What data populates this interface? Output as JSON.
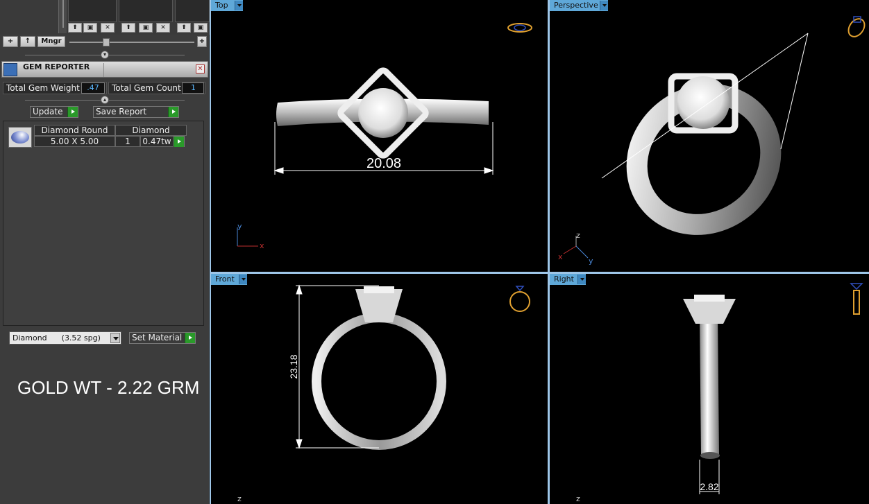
{
  "left_panel": {
    "toolbar": {
      "add_label": "+",
      "up_label": "↑",
      "manager_label": "Mngr",
      "plus_right_label": "+"
    },
    "gem_reporter": {
      "title": "GEM REPORTER",
      "total_gem_weight_label": "Total Gem Weight",
      "total_gem_weight_value": ".47",
      "total_gem_count_label": "Total Gem Count",
      "total_gem_count_value": "1",
      "update_label": "Update",
      "save_report_label": "Save Report",
      "gems": [
        {
          "shape": "Diamond Round",
          "material": "Diamond",
          "size": "5.00 X 5.00",
          "count": "1",
          "weight": "0.47tw"
        }
      ],
      "material_select": "Diamond      (3.52 spg)",
      "set_material_label": "Set Material"
    },
    "gold_weight": "GOLD WT - 2.22 GRM"
  },
  "viewports": {
    "top": {
      "label": "Top",
      "dimension": "20.08",
      "axis_x": "x",
      "axis_y": "y"
    },
    "perspective": {
      "label": "Perspective",
      "axis_x": "x",
      "axis_y": "y",
      "axis_z": "z"
    },
    "front": {
      "label": "Front",
      "dimension": "23.18",
      "axis_z": "z"
    },
    "right": {
      "label": "Right",
      "dimension": "2.82",
      "axis_z": "z"
    }
  },
  "colors": {
    "viewport_tab": "#5fa8d8",
    "viewport_border": "#9ec6e8",
    "panel_bg": "#3c3c3c",
    "value_text": "#5bb8ff",
    "go_button": "#2a9a2a"
  }
}
